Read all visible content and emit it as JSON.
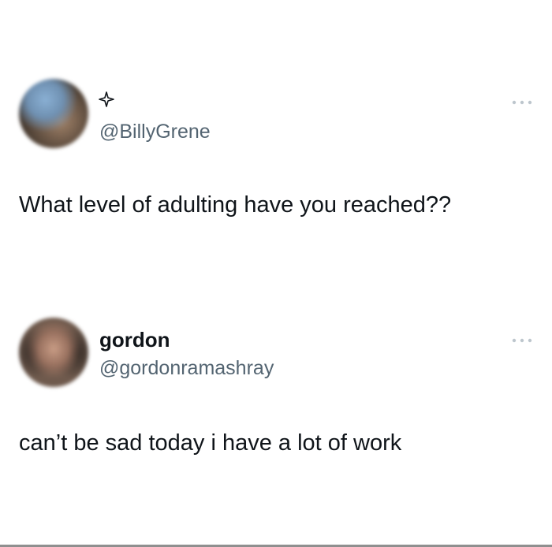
{
  "posts": [
    {
      "avatar_icon": "avatar-blurred",
      "badge_icon": "sparkle-icon",
      "handle": "@BillyGrene",
      "text": "What level of adulting have you reached??",
      "more_icon": "more-options-icon"
    },
    {
      "avatar_icon": "avatar-blurred",
      "name": "gordon",
      "handle": "@gordonramashray",
      "text": "can’t be sad today i have a lot of work",
      "more_icon": "more-options-icon"
    }
  ],
  "colors": {
    "text": "#0f1419",
    "handle": "#536471",
    "background": "#ffffff"
  }
}
